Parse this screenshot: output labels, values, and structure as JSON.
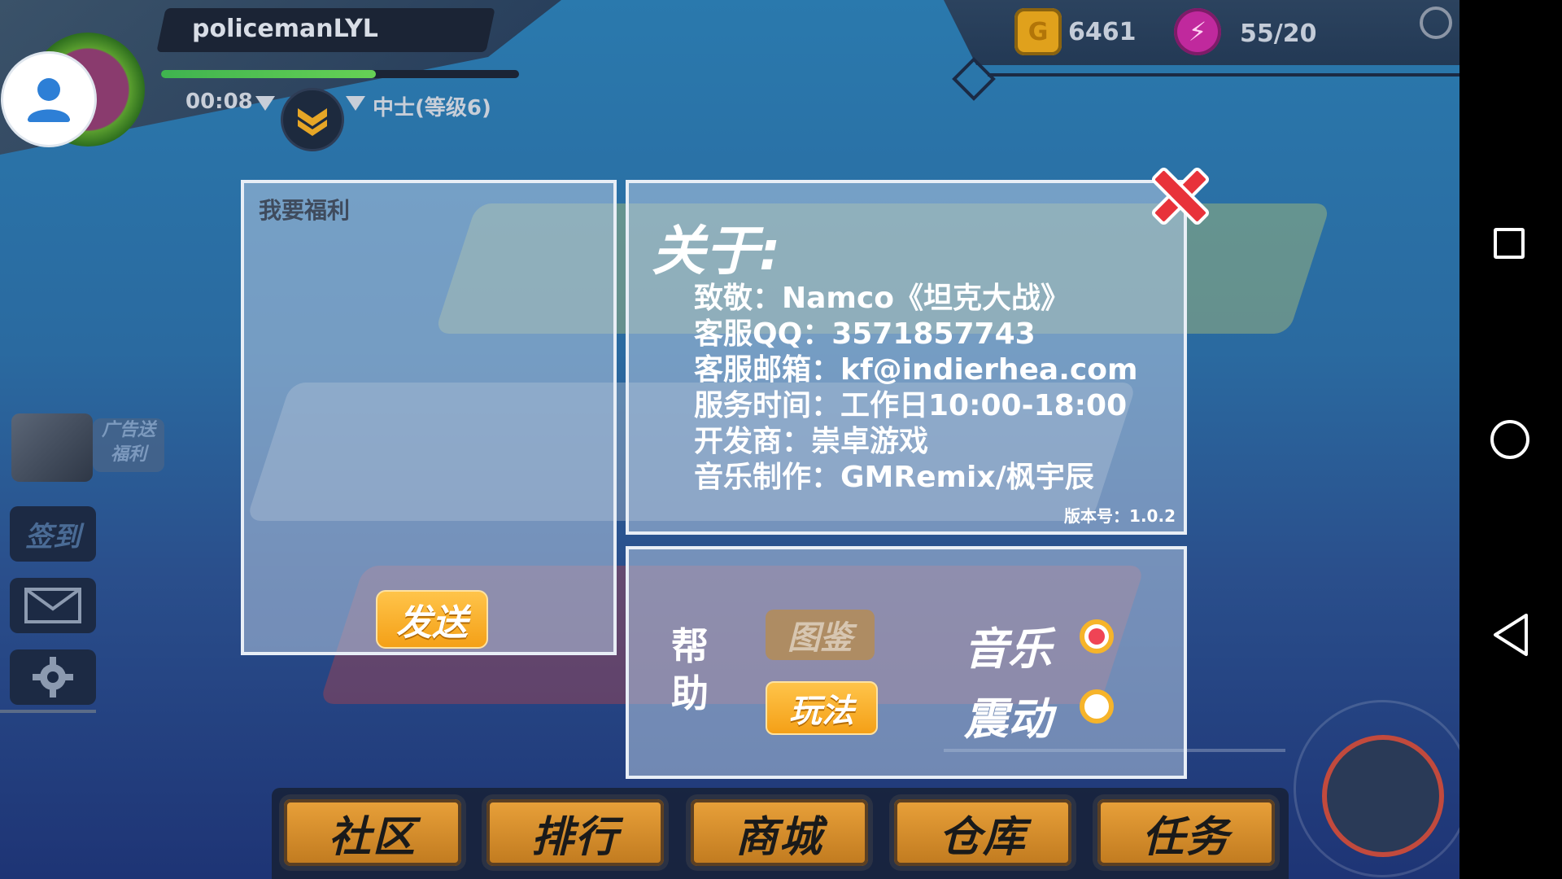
{
  "player": {
    "username": "policemanLYL",
    "timer": "00:08",
    "rank": "中士(等级6)",
    "xp_progress": 0.6
  },
  "currency": {
    "coins": "6461",
    "energy": "55/20"
  },
  "side": {
    "ad_label_line1": "广告送",
    "ad_label_line2": "福利",
    "checkin_label": "签到"
  },
  "welfare": {
    "title": "我要福利",
    "send_label": "发送"
  },
  "about": {
    "title": "关于:",
    "lines": [
      "致敬：Namco《坦克大战》",
      "客服QQ：3571857743",
      "客服邮箱：kf@indierhea.com",
      "服务时间：工作日10:00-18:00",
      "开发商：崇卓游戏",
      "音乐制作：GMRemix/枫宇辰"
    ],
    "version": "版本号：1.0.2"
  },
  "settings": {
    "help_label": "帮助",
    "catalog_label": "图鉴",
    "howto_label": "玩法",
    "music_label": "音乐",
    "vibration_label": "震动",
    "music_on": true,
    "vibration_on": false
  },
  "bottom_nav": [
    "社区",
    "排行",
    "商城",
    "仓库",
    "任务"
  ],
  "colors": {
    "accent_orange": "#f4a017",
    "panel_border": "#e8eef6",
    "music_dot": "#ef4455",
    "close_red": "#e8323a"
  },
  "icons": {
    "avatar": "user-icon",
    "coin": "coin-icon",
    "energy": "lightning-icon",
    "close": "close-icon",
    "mail": "mail-icon",
    "settings": "gear-icon"
  }
}
